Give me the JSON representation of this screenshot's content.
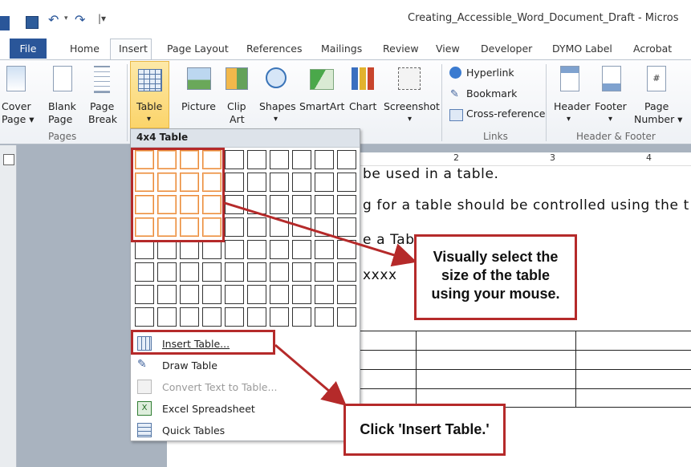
{
  "window": {
    "title": "Creating_Accessible_Word_Document_Draft - Micros"
  },
  "tabs": [
    {
      "label": "File"
    },
    {
      "label": "Home"
    },
    {
      "label": "Insert"
    },
    {
      "label": "Page Layout"
    },
    {
      "label": "References"
    },
    {
      "label": "Mailings"
    },
    {
      "label": "Review"
    },
    {
      "label": "View"
    },
    {
      "label": "Developer"
    },
    {
      "label": "DYMO Label"
    },
    {
      "label": "Acrobat"
    }
  ],
  "ribbon": {
    "pages": {
      "cover_line1": "Cover",
      "cover_line2": "Page ▾",
      "blank_line1": "Blank",
      "blank_line2": "Page",
      "break_line1": "Page",
      "break_line2": "Break",
      "group": "Pages"
    },
    "tables": {
      "table": "Table",
      "arrow": "▾"
    },
    "illustrations": {
      "picture": "Picture",
      "clip_line1": "Clip",
      "clip_line2": "Art",
      "shapes": "Shapes",
      "shapes_arrow": "▾",
      "smartart": "SmartArt",
      "chart": "Chart",
      "screenshot": "Screenshot",
      "screenshot_arrow": "▾"
    },
    "links": {
      "hyperlink": "Hyperlink",
      "bookmark": "Bookmark",
      "crossref": "Cross-reference",
      "group": "Links"
    },
    "header_footer": {
      "header": "Header",
      "header_arrow": "▾",
      "footer": "Footer",
      "footer_arrow": "▾",
      "page_line1": "Page",
      "page_line2": "Number ▾",
      "group": "Header & Footer"
    }
  },
  "ruler": {
    "marks": [
      "2",
      "3",
      "4"
    ]
  },
  "document": {
    "line1": "be used in a table.",
    "line2": "g for a table should be controlled using the t",
    "line3": "e a Tab",
    "line4": "xxxx"
  },
  "dropdown": {
    "header": "4x4 Table",
    "grid": {
      "rows": 8,
      "cols": 10,
      "selected_rows": 4,
      "selected_cols": 4
    },
    "items": [
      {
        "label": "Insert Table...",
        "icon": "insert-table-icon",
        "disabled": false
      },
      {
        "label": "Draw Table",
        "icon": "pencil-icon",
        "disabled": false
      },
      {
        "label": "Convert Text to Table...",
        "icon": "convert-icon",
        "disabled": true
      },
      {
        "label": "Excel Spreadsheet",
        "icon": "excel-icon",
        "disabled": false
      },
      {
        "label": "Quick Tables",
        "icon": "quick-tables-icon",
        "disabled": false
      }
    ]
  },
  "callouts": {
    "select": "Visually select the size of the table using your mouse.",
    "insert": "Click 'Insert Table.'"
  },
  "colors": {
    "accent": "#b52a2a",
    "file_tab": "#2a5699",
    "highlight": "#fbd46a",
    "grid_selected": "#e9893a"
  }
}
